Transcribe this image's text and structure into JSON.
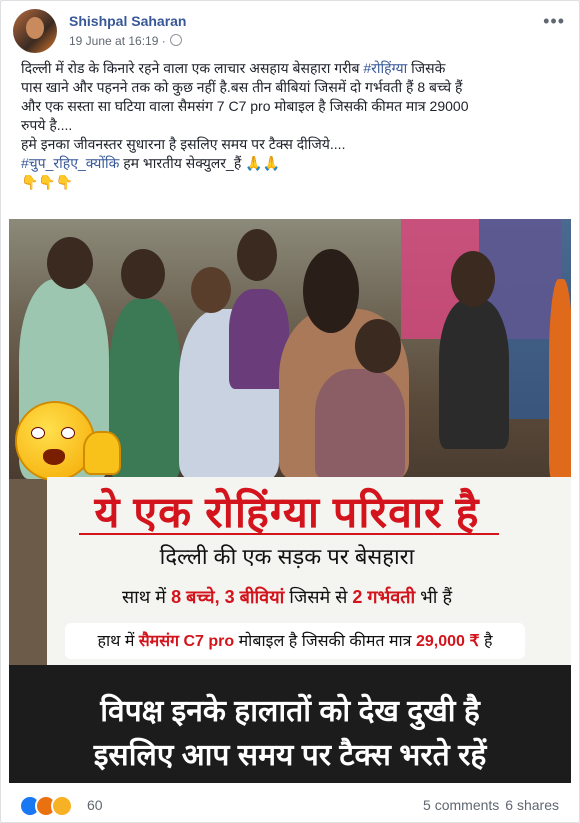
{
  "post": {
    "author": "Shishpal Saharan",
    "timestamp": "19 June at 16:19 ·",
    "more": "•••",
    "text_lines": [
      "दिल्ली में रोड के किनारे रहने वाला एक लाचार असहाय बेसहारा गरीब ",
      "पास खाने और पहनने तक को कुछ नहीं है.बस तीन बीबियां जिसमें दो गर्भवती हैं 8 बच्चे हैं",
      "और एक सस्ता सा घटिया वाला सैमसंग 7 C7 pro मोबाइल है जिसकी कीमत मात्र 29000",
      "रुपये है....",
      "हमे इनका जीवनस्तर सुधारना है इसलिए समय पर टैक्स दीजिये....",
      " हम भारतीय सेक्युलर_हैं 🙏🙏",
      "👇👇👇"
    ],
    "hashtag1": "#रोहिंग्या",
    "hashtag1_suffix": " जिसके",
    "hashtag2": "#चुप_रहिए_क्योंकि"
  },
  "image": {
    "title": "ये एक रोहिंग्या परिवार है",
    "line1": "दिल्ली की एक सड़क पर बेसहारा",
    "line2_a": "साथ में ",
    "line2_b": "8 बच्चे, 3 बीवियां",
    "line2_c": " जिसमे से ",
    "line2_d": "2 गर्भवती",
    "line2_e": " भी हैं",
    "line3_a": "हाथ में ",
    "line3_b": "सैमसंग C7 pro",
    "line3_c": " मोबाइल है जिसकी कीमत मात्र ",
    "line3_d": "29,000 ₹",
    "line3_e": " है",
    "bottom1": "विपक्ष इनके हालातों को देख दुखी है",
    "bottom2": "इसलिए आप समय पर टैक्स भरते रहें"
  },
  "footer": {
    "reaction_count": "60",
    "comments": "5 comments",
    "shares": "6 shares"
  },
  "colors": {
    "link": "#385898",
    "red": "#d3141c",
    "angry": "#e9710f",
    "like": "#1877f2",
    "haha": "#f7b125"
  }
}
